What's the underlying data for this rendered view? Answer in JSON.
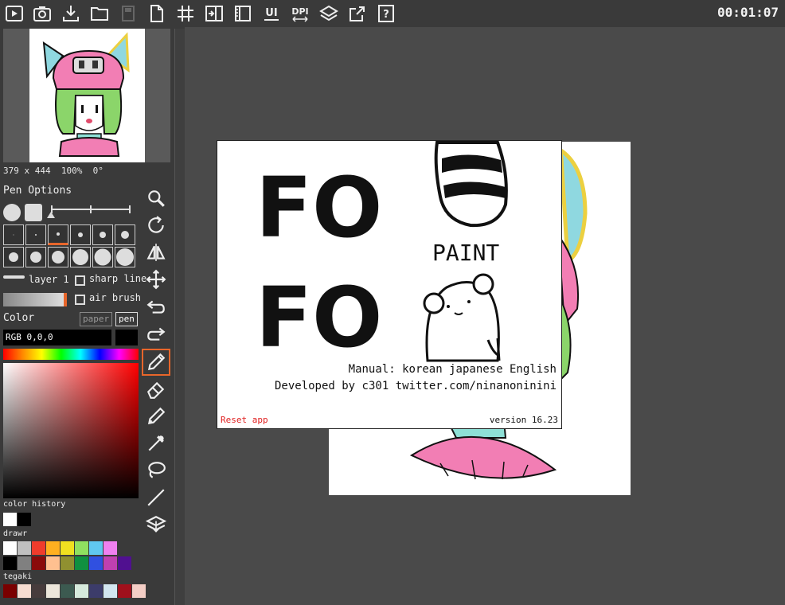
{
  "toolbar": {
    "buttons": [
      "play-icon",
      "camera-icon",
      "download-icon",
      "folder-icon",
      "save-disabled-icon",
      "new-file-icon",
      "grid-icon",
      "split-panel-icon",
      "ruler-icon",
      "ui-icon",
      "dpi-icon",
      "layers-icon",
      "share-icon",
      "help-icon"
    ],
    "ui_label": "UI",
    "dpi_label": "DPI",
    "help_label": "?"
  },
  "timer": "00:01:07",
  "preview_info": {
    "size": "379 x 444",
    "zoom": "100%",
    "rotation": "0°"
  },
  "pen_options": {
    "title": "Pen Options",
    "layer_label": "layer 1",
    "sharp_line_label": "sharp line",
    "air_brush_label": "air brush",
    "sharp_line_checked": false,
    "air_brush_checked": false
  },
  "color": {
    "title": "Color",
    "paper_label": "paper",
    "pen_label": "pen",
    "rgb_text": "RGB 0,0,0",
    "current": "#000000",
    "accent": "#e8662b"
  },
  "color_history": {
    "title": "color history",
    "swatches": [
      "#ffffff",
      "#000000"
    ]
  },
  "drawr": {
    "title": "drawr",
    "row1": [
      "#ffffff",
      "#c0c0c0",
      "#f03c2c",
      "#ffb020",
      "#f0e020",
      "#90e060",
      "#60c8f0",
      "#f080f0"
    ],
    "row2": [
      "#000000",
      "#808080",
      "#8a0a0a",
      "#ffc090",
      "#909030",
      "#109040",
      "#3050e0",
      "#c040b0",
      "#501090"
    ]
  },
  "tegaki": {
    "title": "tegaki",
    "row": [
      "#7a0000",
      "#f6dcd0",
      "#473c3c",
      "#ece6da",
      "#3c5a50",
      "#d6eadc",
      "#3c3c6a",
      "#d2e6f0",
      "#a0101c",
      "#f4cec6"
    ]
  },
  "tools": [
    "magnifier-icon",
    "rotate-icon",
    "flip-icon",
    "move-icon",
    "undo-icon",
    "redo-icon",
    "pen-icon",
    "eraser-icon",
    "pencil-icon",
    "eyedropper-icon",
    "lasso-icon",
    "line-icon",
    "layer-merge-icon"
  ],
  "dialog": {
    "logo_fo1": "FO",
    "logo_fo2": "FO",
    "logo_paint": "PAINT",
    "manual_label": "Manual:",
    "manual_korean": "korean",
    "manual_japanese": "japanese",
    "manual_english": "English",
    "developed": "Developed by c301",
    "twitter": "twitter.com/ninanoninini",
    "reset": "Reset app",
    "version": "version 16.23"
  }
}
